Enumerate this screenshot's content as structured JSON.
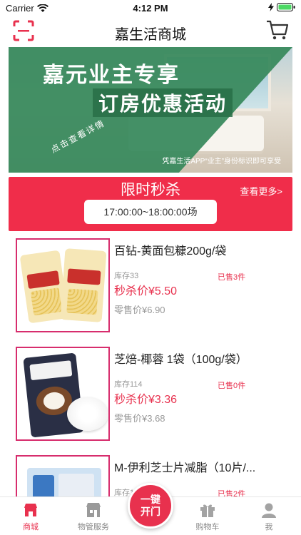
{
  "status_bar": {
    "carrier": "Carrier",
    "time": "4:12 PM"
  },
  "nav": {
    "title": "嘉生活商城",
    "scan_icon": "scan-icon",
    "cart_icon": "cart-icon"
  },
  "banner": {
    "headline": "嘉元业主专享",
    "subline": "订房优惠活动",
    "tap_text": "点击查看详情",
    "note": "凭嘉生活APP“业主”身份标识即可享受"
  },
  "flash_sale": {
    "title": "限时秒杀",
    "more": "查看更多>",
    "time_slot": "17:00:00~18:00:00场"
  },
  "products": [
    {
      "name": "百钻-黄面包糠200g/袋",
      "stock": "库存33",
      "sold": "已售3件",
      "flash_price": "秒杀价¥5.50",
      "retail_price": "零售价¥6.90"
    },
    {
      "name": "芝焙-椰蓉 1袋（100g/袋）",
      "stock": "库存114",
      "sold": "已售0件",
      "flash_price": "秒杀价¥3.36",
      "retail_price": "零售价¥3.68"
    },
    {
      "name": "M-伊利芝士片减脂（10片/...",
      "stock": "库存11",
      "sold": "已售2件"
    }
  ],
  "tab_bar": {
    "items": [
      {
        "label": "商城",
        "icon": "mall-icon"
      },
      {
        "label": "物管服务",
        "icon": "property-icon"
      },
      {
        "label": "购物车",
        "icon": "gift-icon"
      },
      {
        "label": "我",
        "icon": "user-icon"
      }
    ],
    "open_door": {
      "line1": "一键",
      "line2": "开门"
    }
  },
  "colors": {
    "accent": "#e8314e",
    "banner_green": "#3a8a5e"
  }
}
